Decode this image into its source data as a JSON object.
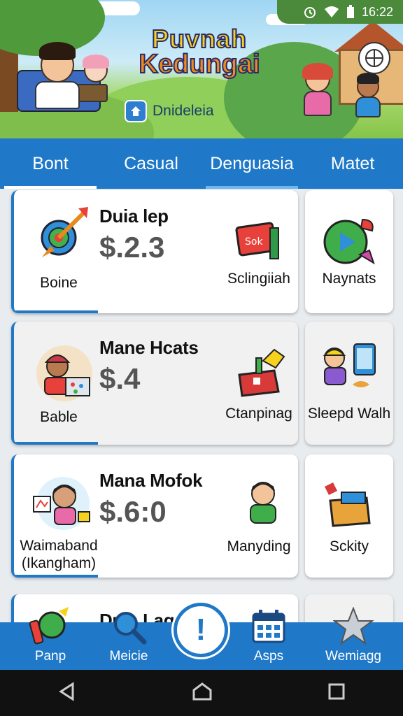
{
  "status_bar": {
    "time": "16:22"
  },
  "header": {
    "title_line1": "Puvnah",
    "title_line2": "Kedungai",
    "subtitle": "Dnideleia",
    "globe_icon": "globe-icon"
  },
  "tabs": [
    {
      "label": "Bont",
      "state": "active"
    },
    {
      "label": "Casual",
      "state": "normal"
    },
    {
      "label": "Denguasia",
      "state": "selected"
    },
    {
      "label": "Matet",
      "state": "normal"
    }
  ],
  "rows": [
    {
      "title": "Duia lep",
      "price": "$.2.3",
      "left_label": "Boine",
      "left_icon": "dart-target-icon",
      "mid_label": "Sclingiiah",
      "mid_icon": "sign-icon",
      "mid_sign_text": "Sok",
      "side_label": "Naynats",
      "side_icon": "play-ball-icon"
    },
    {
      "title": "Mane Hcats",
      "price": "$.4",
      "left_label": "Bable",
      "left_icon": "kid-laptop-icon",
      "mid_label": "Ctanpinag",
      "mid_icon": "gift-box-icon",
      "side_label": "Sleepd Walh",
      "side_icon": "kid-tablet-icon"
    },
    {
      "title": "Mana Mofok",
      "price": "$.6:0",
      "left_label": "Waimaband (Ikangham)",
      "left_icon": "kid-painting-icon",
      "mid_label": "Manyding",
      "mid_icon": "kid-icon",
      "side_label": "Sckity",
      "side_icon": "toolbox-icon"
    },
    {
      "title": "Duia Laqx",
      "left_icon": "paint-tools-icon"
    }
  ],
  "bottom_nav": [
    {
      "label": "Panp",
      "icon": "paint-icon"
    },
    {
      "label": "Meicie",
      "icon": "search-icon"
    },
    {
      "label": "Asps",
      "icon": "calendar-icon"
    },
    {
      "label": "Wemiagg",
      "icon": "star-icon"
    }
  ],
  "fab": {
    "glyph": "!",
    "icon": "alert-icon"
  },
  "colors": {
    "primary": "#1f78c8",
    "price": "#555555",
    "card": "#ffffff"
  }
}
